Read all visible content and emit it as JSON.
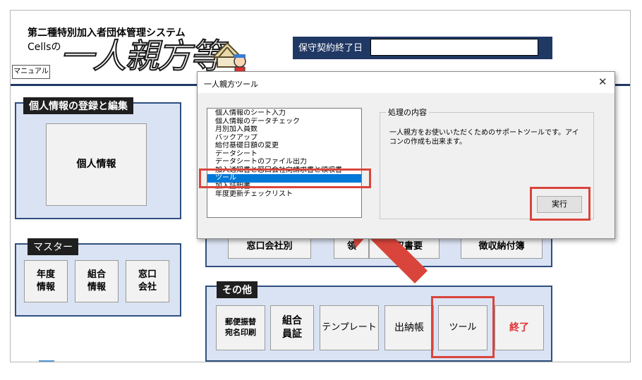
{
  "app": {
    "system_title": "第二種特別加入者団体管理システム",
    "cells_label": "Cellsの",
    "logo_text": "一人親方等",
    "manual_button": "マニュアル",
    "expire_label": "保守契約終了日",
    "expire_value": ""
  },
  "groups": {
    "personal": {
      "title": "個人情報の登録と編集",
      "buttons": [
        "個人情報"
      ]
    },
    "master": {
      "title": "マスター",
      "buttons": [
        [
          "年度",
          "情報"
        ],
        [
          "組合",
          "情報"
        ],
        [
          "窓口",
          "会社"
        ]
      ]
    },
    "middle": {
      "buttons": [
        "窓口会社別",
        "領",
        "領収書要",
        "徴収納付簿"
      ]
    },
    "other": {
      "title": "その他",
      "buttons": [
        [
          "郵便振替",
          "宛名印刷"
        ],
        [
          "組合",
          "員証"
        ],
        [
          "テンプレート"
        ],
        [
          "出納帳"
        ],
        [
          "ツール"
        ],
        [
          "終了"
        ]
      ]
    }
  },
  "dialog": {
    "title": "一人親方ツール",
    "list_items": [
      "個人情報のシート入力",
      "個人情報のデータチェック",
      "月別加入員数",
      "バックアップ",
      "給付基礎日額の変更",
      "データシート",
      "データシートのファイル出力",
      "加入通知書と窓口会社向請求書と領収書",
      "ツール",
      "加入証明書",
      "年度更新チェックリスト"
    ],
    "selected_index": 8,
    "group_label": "処理の内容",
    "description": "一人親方をお使いいただくためのサポートツールです。アイコンの作成も出来ます。",
    "execute_button": "実行"
  },
  "colors": {
    "highlight": "#d9453b",
    "selection": "#0078d7",
    "group_bg": "#dae3f3",
    "navy": "#203864",
    "exit_text": "#e03030"
  }
}
